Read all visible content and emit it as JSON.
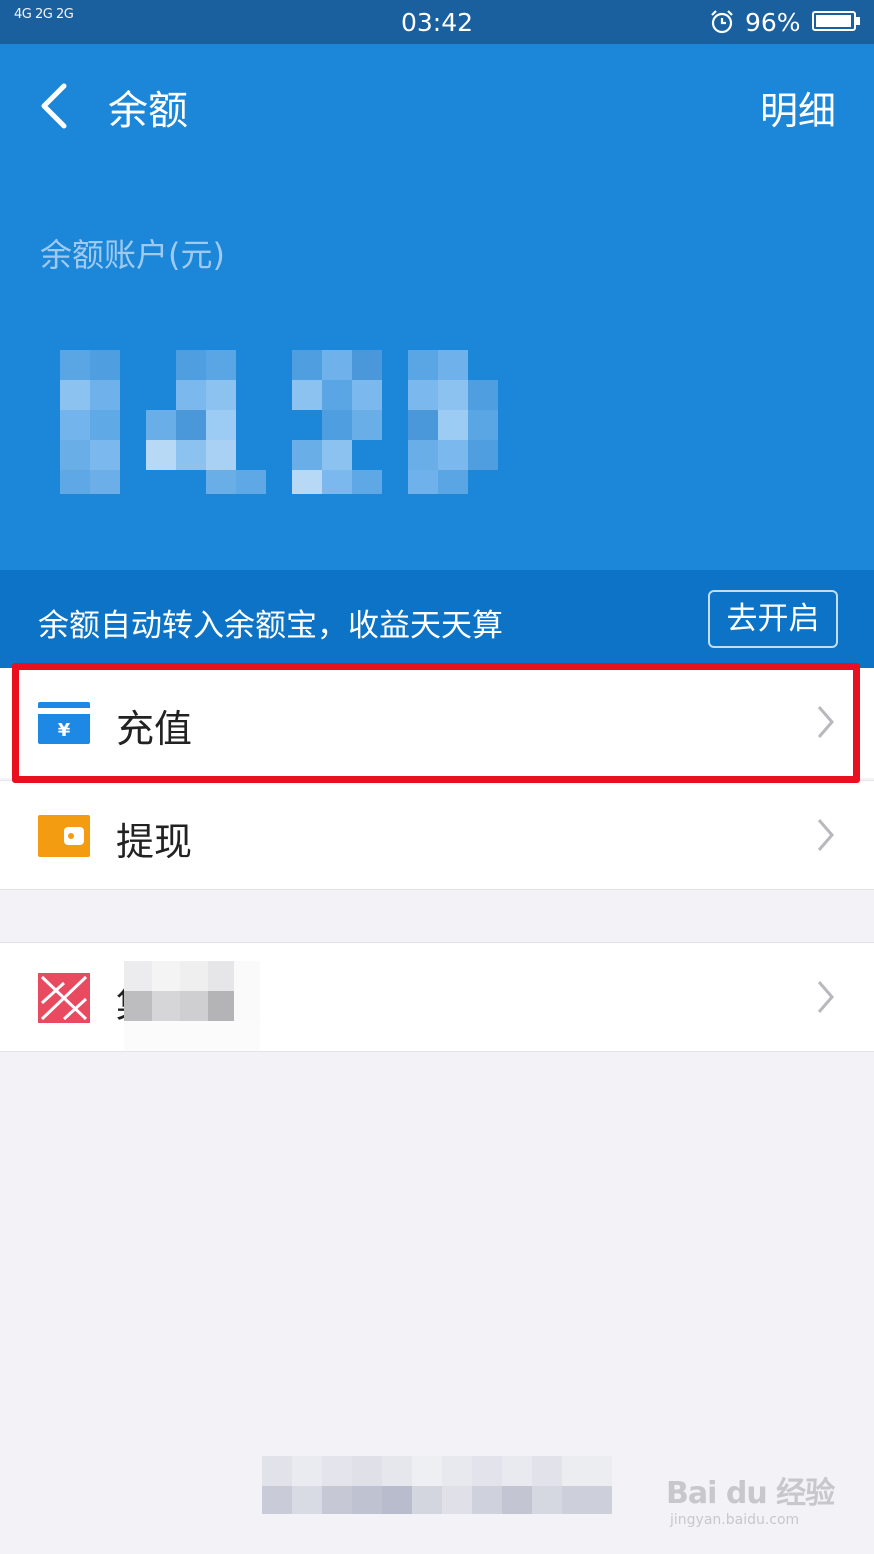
{
  "status_bar": {
    "signal": "4G 2G 2G",
    "time": "03:42",
    "battery_percent": "96%"
  },
  "header": {
    "title": "余额",
    "detail_link": "明细",
    "account_label": "余额账户(元)"
  },
  "notice": {
    "text": "余额自动转入余额宝，收益天天算",
    "button": "去开启"
  },
  "menu": {
    "recharge": "充值",
    "withdraw": "提现",
    "other": "集"
  },
  "watermark": {
    "main": "Bai du 经验",
    "sub": "jingyan.baidu.com"
  },
  "colors": {
    "header_blue": "#1c86d8",
    "notice_blue": "#0c73c6",
    "highlight_red": "#e8101e",
    "withdraw_orange": "#f39c12"
  }
}
